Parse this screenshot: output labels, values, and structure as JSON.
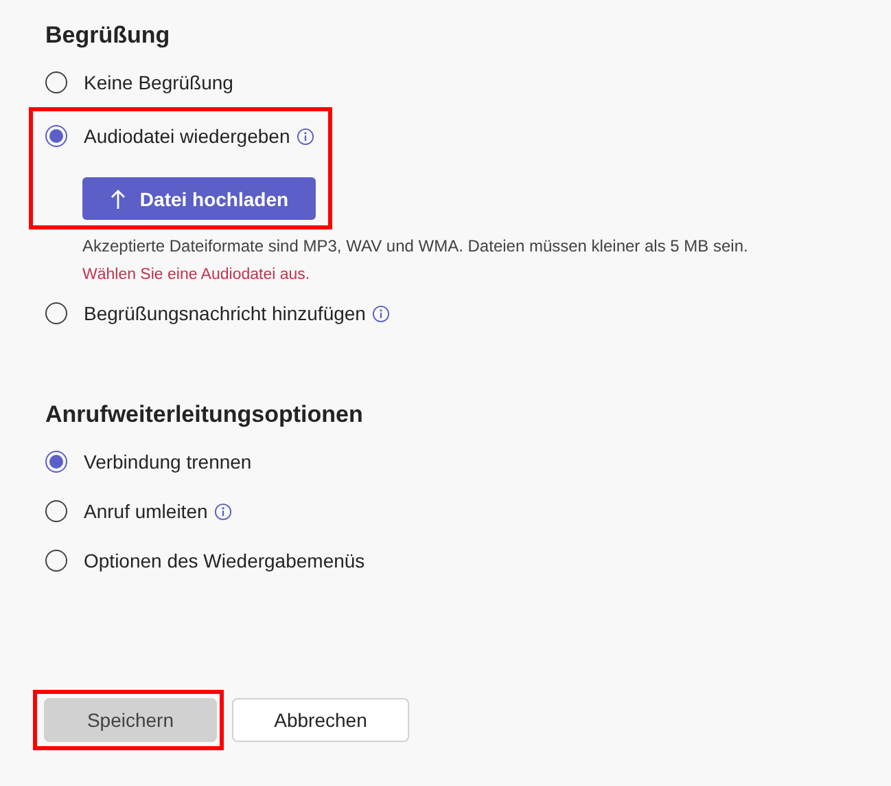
{
  "sections": [
    {
      "title": "Begrüßung",
      "options": [
        {
          "label": "Keine Begrüßung",
          "selected": false,
          "info": false,
          "highlighted": false
        },
        {
          "label": "Audiodatei wiedergeben",
          "selected": true,
          "info": true,
          "highlighted": true,
          "upload": {
            "button": "Datei hochladen",
            "hint": "Akzeptierte Dateiformate sind MP3, WAV und WMA. Dateien müssen kleiner als 5 MB sein.",
            "error": "Wählen Sie eine Audiodatei aus."
          }
        },
        {
          "label": "Begrüßungsnachricht hinzufügen",
          "selected": false,
          "info": true,
          "highlighted": false
        }
      ]
    },
    {
      "title": "Anrufweiterleitungsoptionen",
      "options": [
        {
          "label": "Verbindung trennen",
          "selected": true,
          "info": false,
          "highlighted": false
        },
        {
          "label": "Anruf umleiten",
          "selected": false,
          "info": true,
          "highlighted": false
        },
        {
          "label": "Optionen des Wiedergabemenüs",
          "selected": false,
          "info": false,
          "highlighted": false
        }
      ]
    }
  ],
  "buttons": [
    {
      "label": "Speichern",
      "kind": "primary",
      "disabled": true,
      "highlighted": true
    },
    {
      "label": "Abbrechen",
      "kind": "secondary",
      "disabled": false,
      "highlighted": false
    }
  ]
}
